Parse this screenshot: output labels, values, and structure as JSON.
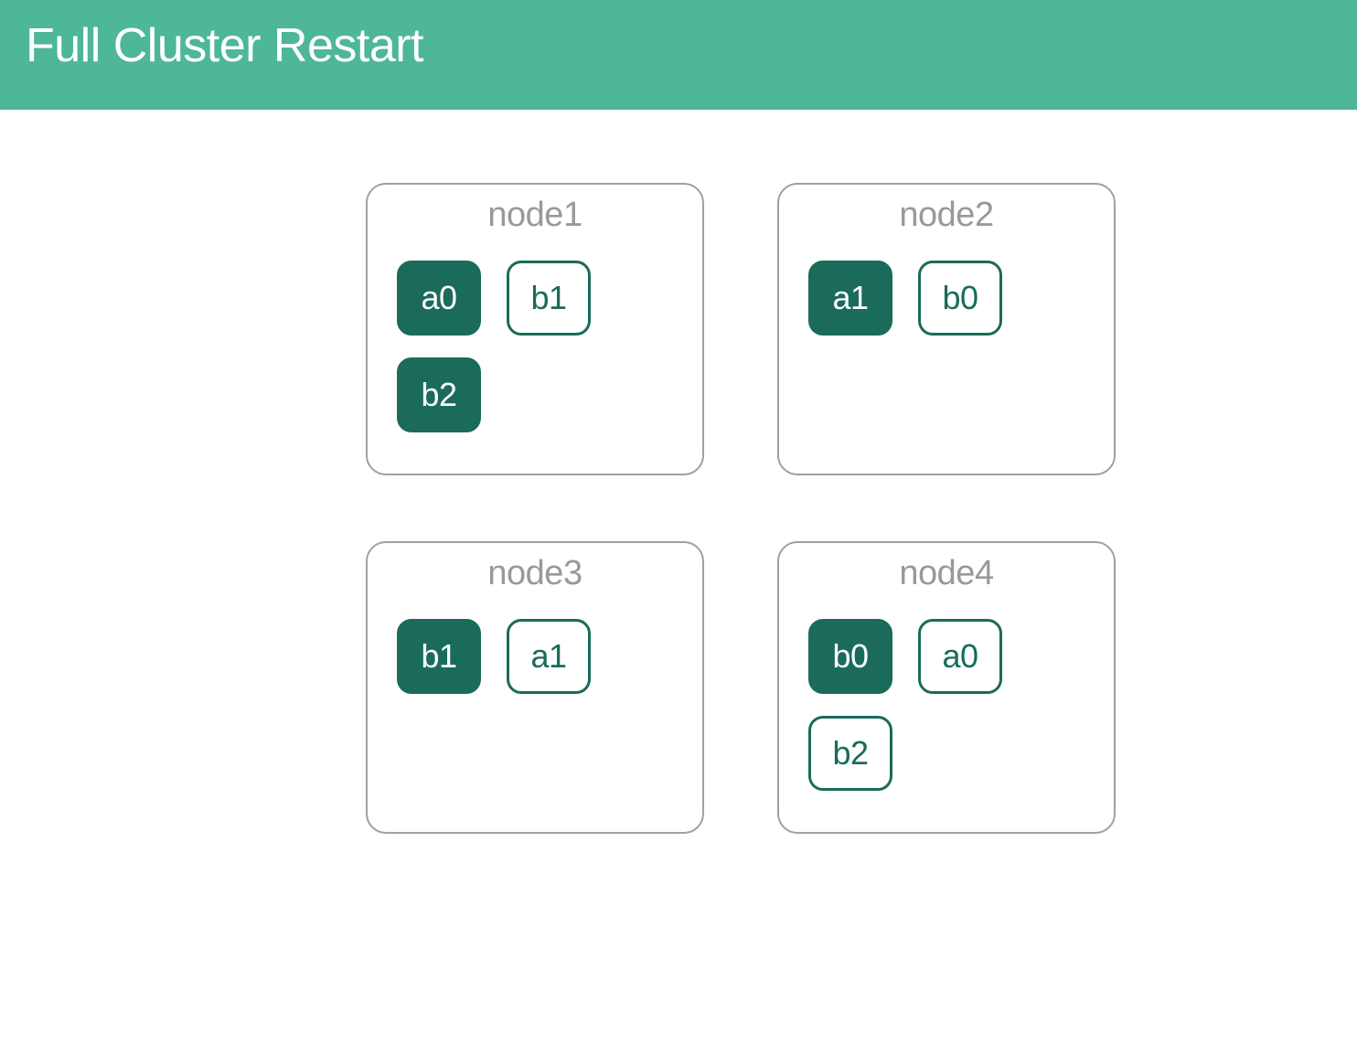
{
  "header": {
    "title": "Full Cluster Restart"
  },
  "colors": {
    "header_bg": "#4db798",
    "shard_primary_bg": "#1a6b5a",
    "shard_primary_fg": "#ffffff",
    "shard_replica_border": "#1a6b5a",
    "shard_replica_fg": "#1a6b5a",
    "node_border": "#a0a0a0",
    "node_label": "#999999"
  },
  "nodes": [
    {
      "label": "node1",
      "rows": [
        [
          {
            "label": "a0",
            "kind": "primary"
          },
          {
            "label": "b1",
            "kind": "replica"
          }
        ],
        [
          {
            "label": "b2",
            "kind": "primary"
          }
        ]
      ]
    },
    {
      "label": "node2",
      "rows": [
        [
          {
            "label": "a1",
            "kind": "primary"
          },
          {
            "label": "b0",
            "kind": "replica"
          }
        ]
      ]
    },
    {
      "label": "node3",
      "rows": [
        [
          {
            "label": "b1",
            "kind": "primary"
          },
          {
            "label": "a1",
            "kind": "replica"
          }
        ]
      ]
    },
    {
      "label": "node4",
      "rows": [
        [
          {
            "label": "b0",
            "kind": "primary"
          },
          {
            "label": "a0",
            "kind": "replica"
          }
        ],
        [
          {
            "label": "b2",
            "kind": "replica"
          }
        ]
      ]
    }
  ]
}
